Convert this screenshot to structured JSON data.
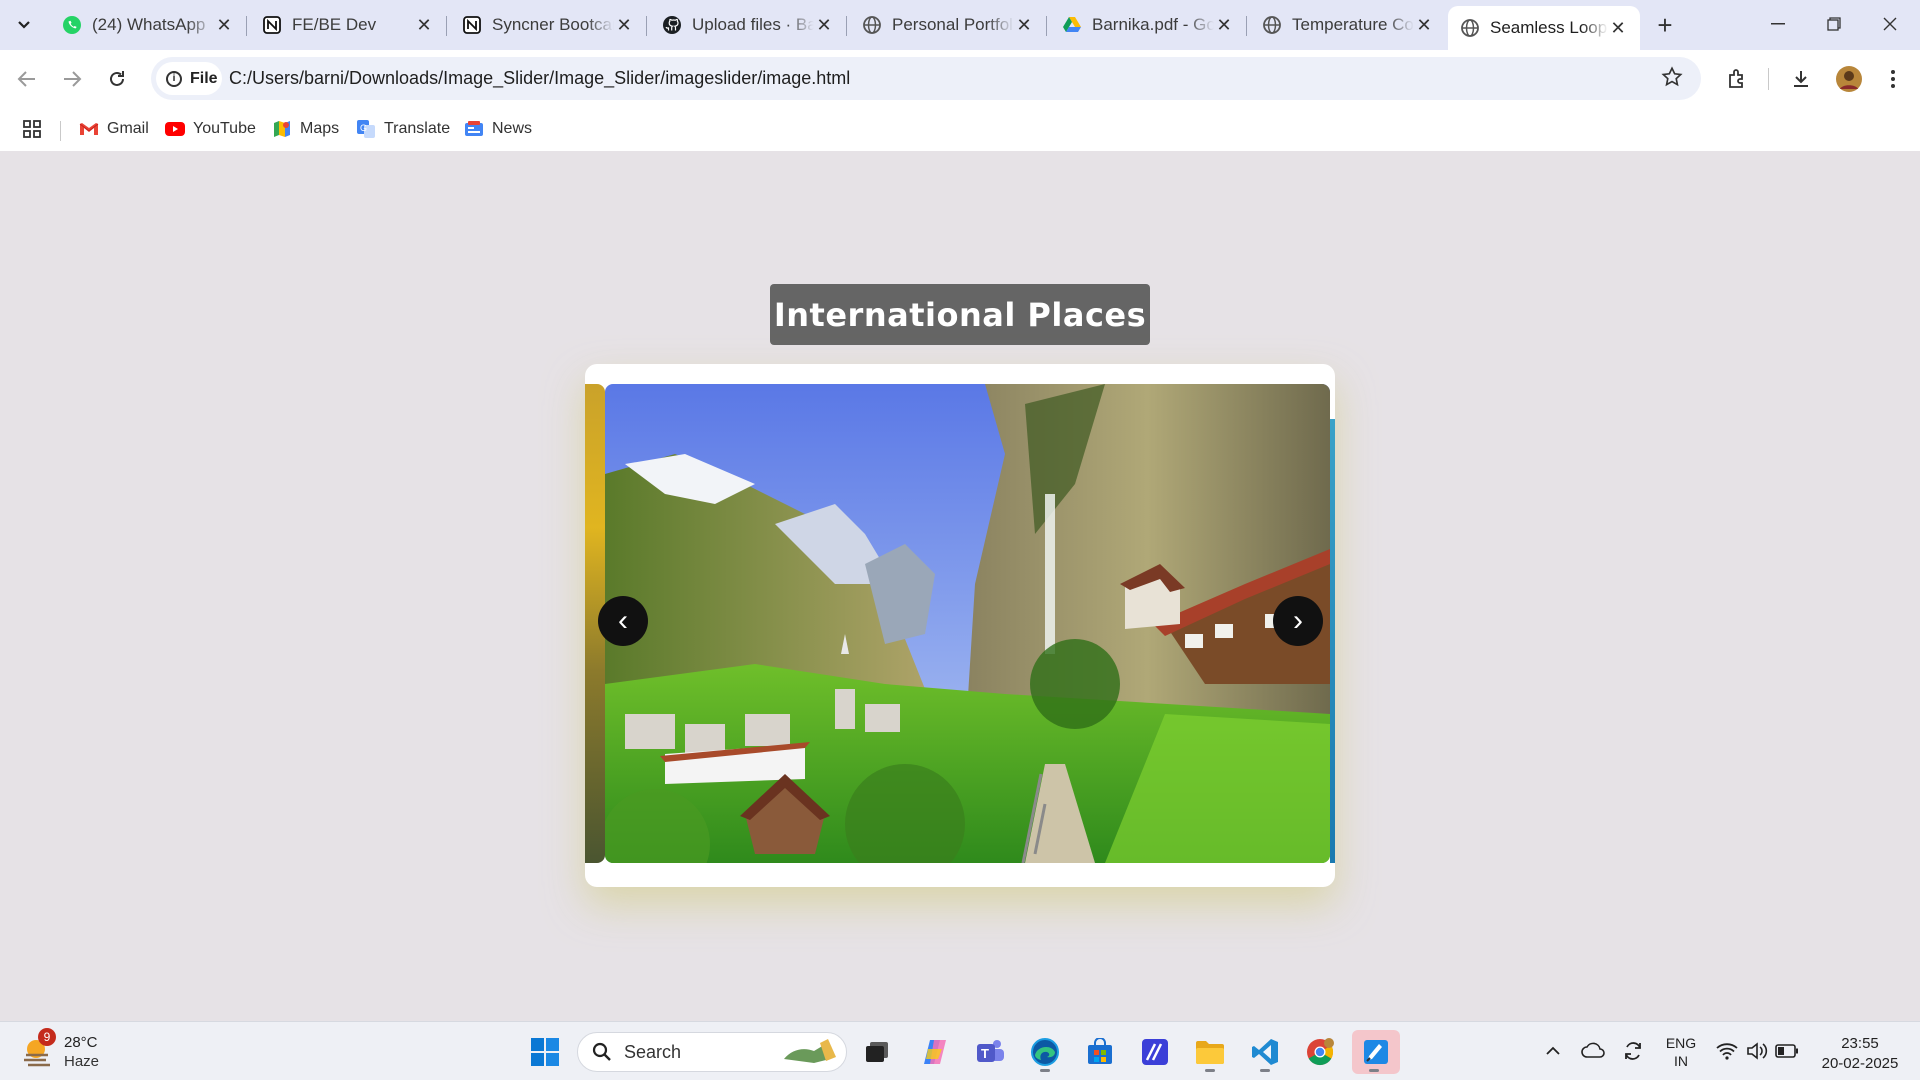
{
  "tabs": [
    {
      "title": "(24) WhatsApp",
      "icon": "whatsapp-icon"
    },
    {
      "title": "FE/BE Dev",
      "icon": "notion-icon"
    },
    {
      "title": "Syncner Bootcamp",
      "icon": "notion-icon"
    },
    {
      "title": "Upload files · Barnika",
      "icon": "github-icon"
    },
    {
      "title": "Personal Portfolio",
      "icon": "globe-icon"
    },
    {
      "title": "Barnika.pdf - Google Drive",
      "icon": "drive-icon"
    },
    {
      "title": "Temperature Converter",
      "icon": "globe-icon"
    },
    {
      "title": "Seamless Looping",
      "icon": "globe-icon",
      "active": true
    }
  ],
  "toolbar": {
    "chip_label": "File",
    "url": "C:/Users/barni/Downloads/Image_Slider/Image_Slider/imageslider/image.html"
  },
  "bookmarks": [
    {
      "label": "Gmail",
      "icon": "gmail-icon"
    },
    {
      "label": "YouTube",
      "icon": "youtube-icon"
    },
    {
      "label": "Maps",
      "icon": "maps-icon"
    },
    {
      "label": "Translate",
      "icon": "translate-icon"
    },
    {
      "label": "News",
      "icon": "news-icon"
    }
  ],
  "page": {
    "heading": "International Places",
    "prev_arrow": "‹",
    "next_arrow": "›",
    "slide_image": "alpine-valley-waterfall-village"
  },
  "taskbar": {
    "weather_badge": "9",
    "temperature": "28°C",
    "condition": "Haze",
    "search_placeholder": "Search",
    "lang_top": "ENG",
    "lang_bottom": "IN",
    "time": "23:55",
    "date": "20-02-2025"
  },
  "colors": {
    "page_bg": "#e6e2e6",
    "heading_bg": "#656565",
    "tabstrip_bg": "#e3e6f6",
    "arrow_bg": "#111111"
  }
}
